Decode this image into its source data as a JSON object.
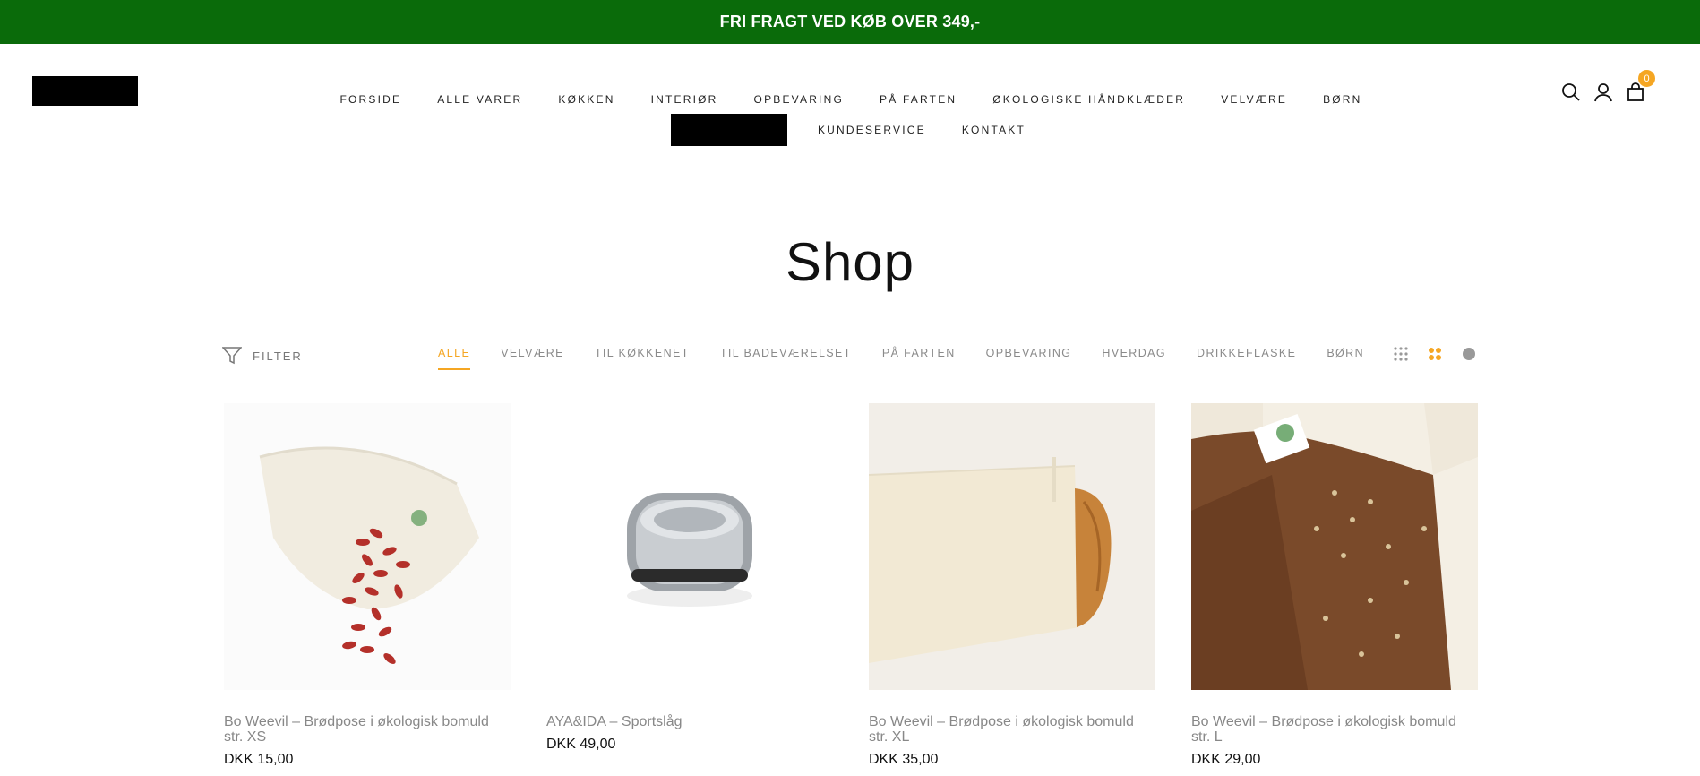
{
  "banner": {
    "text": "FRI FRAGT VED KØB OVER 349,-"
  },
  "nav": {
    "row1": [
      "FORSIDE",
      "ALLE VARER",
      "KØKKEN",
      "INTERIØR",
      "OPBEVARING",
      "PÅ FARTEN",
      "ØKOLOGISKE HÅNDKLÆDER",
      "VELVÆRE",
      "BØRN"
    ],
    "row2": [
      "KUNDESERVICE",
      "KONTAKT"
    ]
  },
  "header": {
    "cart_count": "0",
    "icons": [
      "search-icon",
      "account-icon",
      "cart-icon"
    ]
  },
  "page": {
    "title": "Shop"
  },
  "toolbar": {
    "filter_label": "FILTER",
    "categories": [
      "ALLE",
      "VELVÆRE",
      "TIL KØKKENET",
      "TIL BADEVÆRELSET",
      "PÅ FARTEN",
      "OPBEVARING",
      "HVERDAG",
      "DRIKKEFLASKE",
      "BØRN"
    ],
    "active_category": "ALLE",
    "accent_color": "#f5a623"
  },
  "products": [
    {
      "name": "Bo Weevil – Brødpose i økologisk bomuld str. XS",
      "price": "DKK 15,00"
    },
    {
      "name": "AYA&IDA – Sportslåg",
      "price": "DKK 49,00"
    },
    {
      "name": "Bo Weevil – Brødpose i økologisk bomuld str. XL",
      "price": "DKK 35,00"
    },
    {
      "name": "Bo Weevil – Brødpose i økologisk bomuld str. L",
      "price": "DKK 29,00"
    }
  ]
}
